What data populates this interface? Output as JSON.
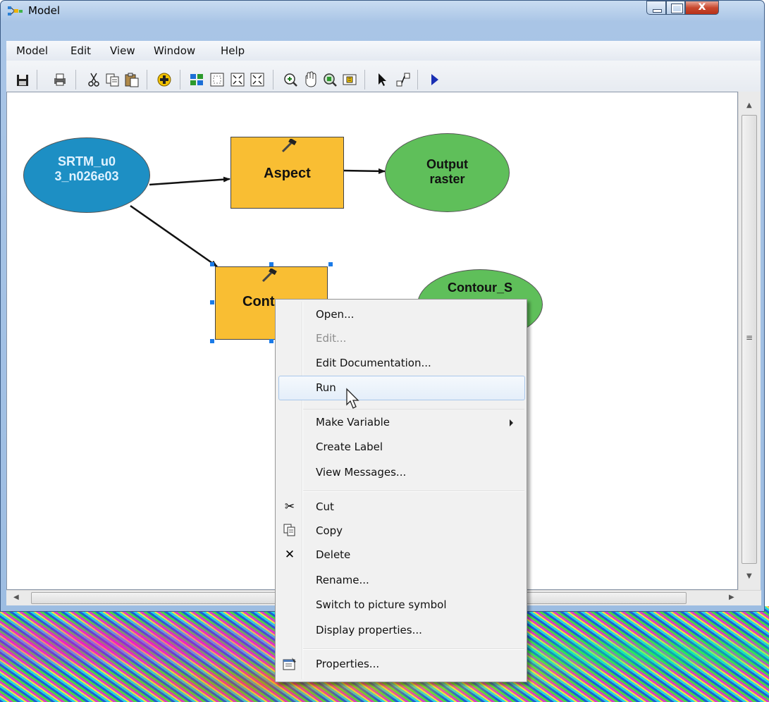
{
  "window": {
    "title": "Model",
    "close_glyph": "x",
    "buttons": [
      "minimize-icon",
      "maximize-icon",
      "close-icon"
    ]
  },
  "menubar": {
    "items": [
      {
        "label": "Model"
      },
      {
        "label": "Edit"
      },
      {
        "label": "View"
      },
      {
        "label": "Window"
      },
      {
        "label": "Help"
      }
    ]
  },
  "toolbar": {
    "icons": [
      "save-icon",
      "print-icon",
      "cut-icon",
      "copy-icon",
      "paste-icon",
      "add-data-icon",
      "auto-layout-icon",
      "full-extent-icon",
      "zoom-in-fixed-icon",
      "zoom-out-fixed-icon",
      "zoom-in-icon",
      "pan-icon",
      "zoom-to-icon",
      "overview-icon",
      "select-icon",
      "connect-icon",
      "run-icon"
    ]
  },
  "diagram": {
    "input": {
      "line1": "SRTM_u0",
      "line2": "3_n026e03",
      "color": "#1d8fc4"
    },
    "tool_aspect": {
      "label": "Aspect",
      "color": "#f9be33"
    },
    "output_raster": {
      "line1": "Output",
      "line2": "raster",
      "color": "#5fbf5a"
    },
    "tool_contour": {
      "label": "Cont"
    },
    "output_contour": {
      "line1": "Contour_S"
    }
  },
  "context_menu": {
    "items": [
      {
        "label": "Open...",
        "enabled": true
      },
      {
        "label": "Edit...",
        "enabled": false
      },
      {
        "label": "Edit Documentation...",
        "enabled": true
      },
      {
        "label": "Run",
        "enabled": true,
        "hovered": true
      },
      {
        "label": "Make Variable",
        "enabled": true,
        "submenu": true
      },
      {
        "label": "Create Label",
        "enabled": true
      },
      {
        "label": "View Messages...",
        "enabled": true
      },
      {
        "label": "Cut",
        "enabled": true,
        "icon": "scissors-icon",
        "glyph": "✂"
      },
      {
        "label": "Copy",
        "enabled": true,
        "icon": "copy-icon"
      },
      {
        "label": "Delete",
        "enabled": true,
        "icon": "delete-icon",
        "glyph": "✕"
      },
      {
        "label": "Rename...",
        "enabled": true
      },
      {
        "label": "Switch to picture symbol",
        "enabled": true
      },
      {
        "label": "Display properties...",
        "enabled": true
      },
      {
        "label": "Properties...",
        "enabled": true,
        "icon": "properties-icon"
      }
    ]
  },
  "colors": {
    "tool_fill": "#f9be33",
    "input_fill": "#1d8fc4",
    "output_fill": "#5fbf5a",
    "selection_handle": "#1b7be8"
  }
}
